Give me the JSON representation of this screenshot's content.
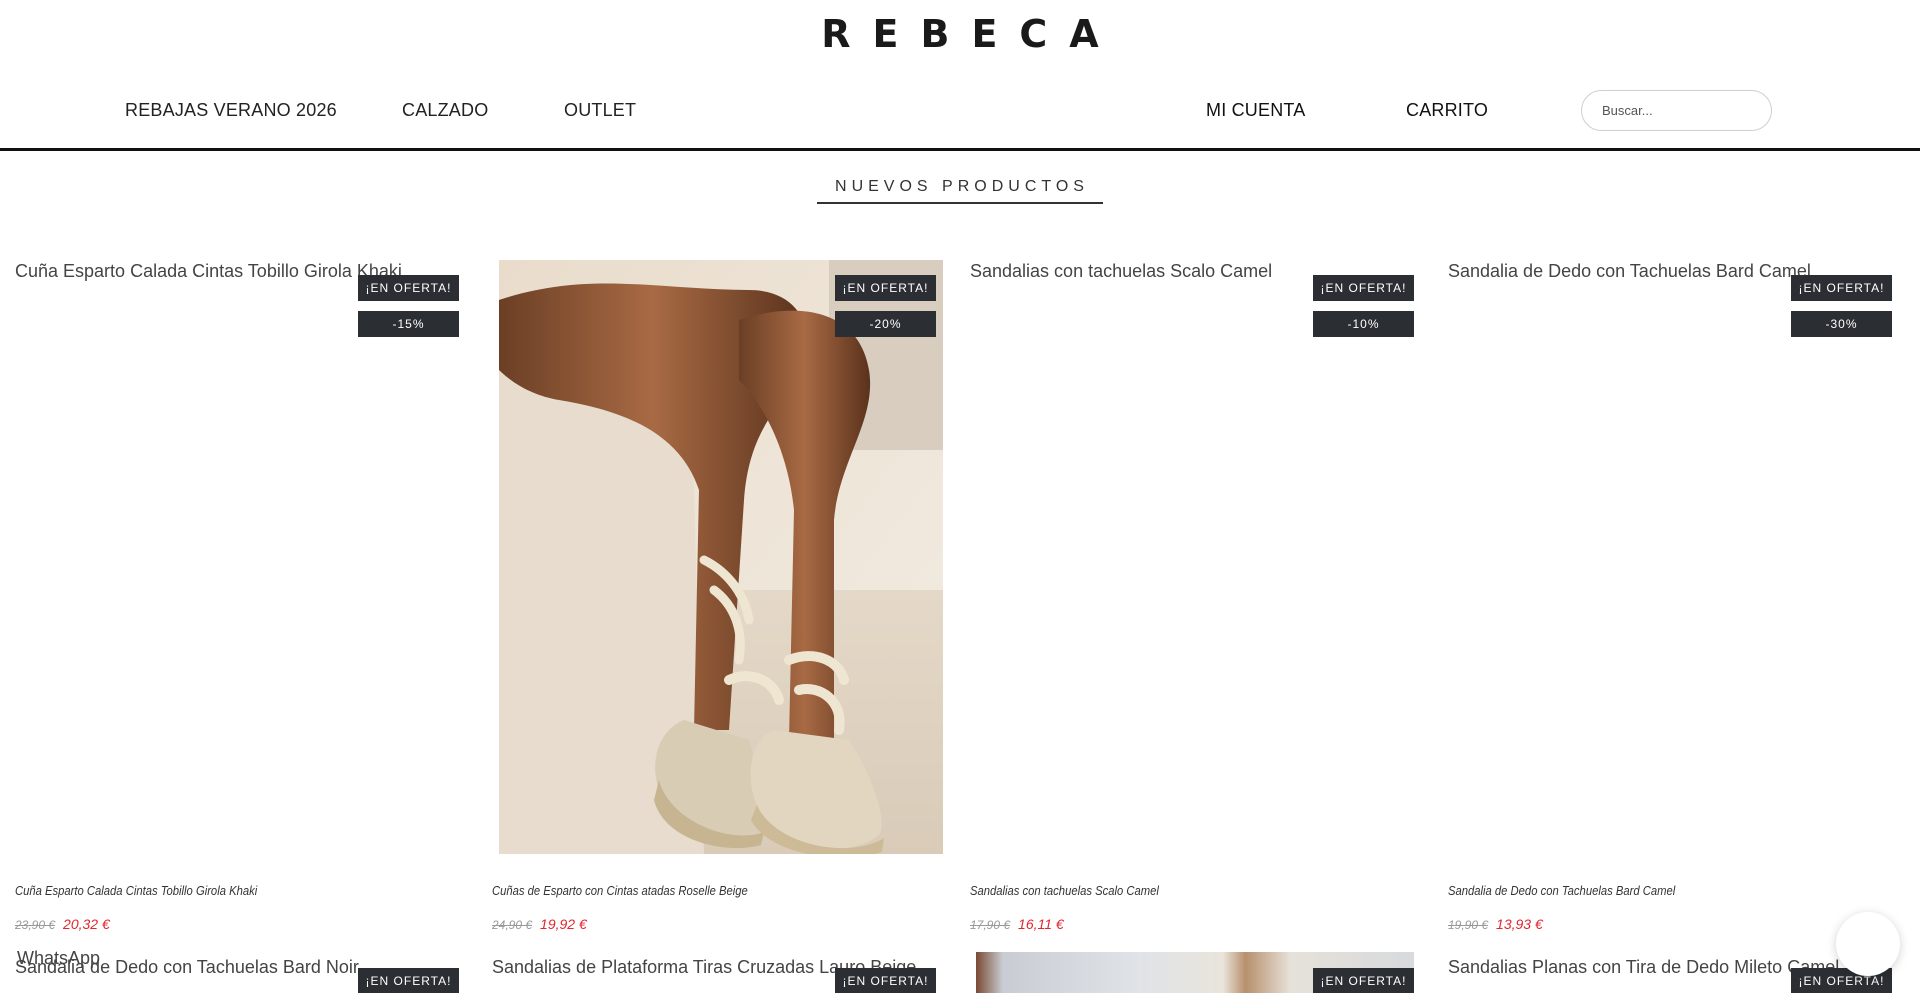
{
  "logo": "REBECA",
  "nav": {
    "left": [
      "REBAJAS VERANO 2026",
      "CALZADO",
      "OUTLET"
    ],
    "account": "MI CUENTA",
    "cart": "CARRITO",
    "search_placeholder": "Buscar..."
  },
  "section_title": "NUEVOS PRODUCTOS",
  "products": [
    {
      "alt": "Cuña Esparto Calada Cintas Tobillo Girola Khaki",
      "offer": "¡EN OFERTA!",
      "discount": "-15%",
      "name": "Cuña Esparto Calada Cintas Tobillo Girola Khaki",
      "old_price": "23,90 €",
      "new_price": "20,32 €"
    },
    {
      "alt": "",
      "offer": "¡EN OFERTA!",
      "discount": "-20%",
      "name": "Cuñas de Esparto con Cintas atadas Roselle Beige",
      "old_price": "24,90 €",
      "new_price": "19,92 €"
    },
    {
      "alt": "Sandalias con tachuelas Scalo Camel",
      "offer": "¡EN OFERTA!",
      "discount": "-10%",
      "name": "Sandalias con tachuelas Scalo Camel",
      "old_price": "17,90 €",
      "new_price": "16,11 €"
    },
    {
      "alt": "Sandalia de Dedo con Tachuelas Bard Camel",
      "offer": "¡EN OFERTA!",
      "discount": "-30%",
      "name": "Sandalia de Dedo con Tachuelas Bard Camel",
      "old_price": "19,90 €",
      "new_price": "13,93 €"
    }
  ],
  "row2": [
    {
      "alt": "Sandalia de Dedo con Tachuelas Bard Noir",
      "offer": "¡EN OFERTA!"
    },
    {
      "alt": "Sandalias de Plataforma Tiras Cruzadas Lauro Beige",
      "offer": "¡EN OFERTA!"
    },
    {
      "alt": "",
      "offer": "¡EN OFERTA!"
    },
    {
      "alt": "Sandalias Planas con Tira de Dedo Mileto Camel",
      "offer": "¡EN OFERTA!"
    }
  ],
  "whatsapp_alt": "WhatsApp",
  "colors": {
    "sale_price": "#e0262e",
    "badge_bg": "#2b2f33"
  }
}
